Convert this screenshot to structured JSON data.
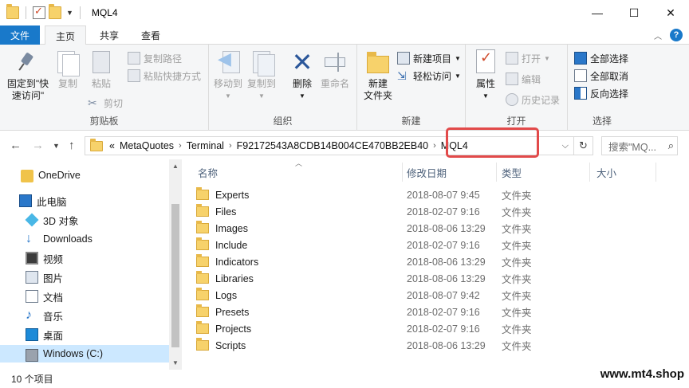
{
  "window": {
    "title": "MQL4",
    "minimize": "—",
    "maximize": "☐",
    "close": "✕"
  },
  "ribbon_tabs": {
    "file": "文件",
    "home": "主页",
    "share": "共享",
    "view": "查看"
  },
  "ribbon": {
    "clipboard": {
      "pin_label_1": "固定到\"快",
      "pin_label_2": "速访问\"",
      "copy": "复制",
      "paste": "粘贴",
      "copy_path": "复制路径",
      "paste_shortcut": "粘贴快捷方式",
      "cut": "剪切",
      "group": "剪贴板"
    },
    "organize": {
      "move_to": "移动到",
      "copy_to": "复制到",
      "delete": "删除",
      "rename": "重命名",
      "group": "组织"
    },
    "new": {
      "new_folder_1": "新建",
      "new_folder_2": "文件夹",
      "new_item": "新建项目",
      "easy_access": "轻松访问",
      "group": "新建"
    },
    "open": {
      "properties": "属性",
      "open": "打开",
      "edit": "编辑",
      "history": "历史记录",
      "group": "打开"
    },
    "select": {
      "select_all": "全部选择",
      "select_none": "全部取消",
      "invert": "反向选择",
      "group": "选择"
    }
  },
  "address": {
    "overflow": "«",
    "crumbs": [
      "MetaQuotes",
      "Terminal",
      "F92172543A8CDB14B004CE470BB2EB40",
      "MQL4"
    ],
    "search_placeholder": "搜索\"MQ..."
  },
  "nav": {
    "onedrive": "OneDrive",
    "thispc": "此电脑",
    "objects3d": "3D 对象",
    "downloads": "Downloads",
    "videos": "视频",
    "pictures": "图片",
    "documents": "文档",
    "music": "音乐",
    "desktop": "桌面",
    "drive_c": "Windows (C:)"
  },
  "columns": {
    "name": "名称",
    "modified": "修改日期",
    "type": "类型",
    "size": "大小"
  },
  "files": [
    {
      "name": "Experts",
      "date": "2018-08-07 9:45",
      "type": "文件夹"
    },
    {
      "name": "Files",
      "date": "2018-02-07 9:16",
      "type": "文件夹"
    },
    {
      "name": "Images",
      "date": "2018-08-06 13:29",
      "type": "文件夹"
    },
    {
      "name": "Include",
      "date": "2018-02-07 9:16",
      "type": "文件夹"
    },
    {
      "name": "Indicators",
      "date": "2018-08-06 13:29",
      "type": "文件夹"
    },
    {
      "name": "Libraries",
      "date": "2018-08-06 13:29",
      "type": "文件夹"
    },
    {
      "name": "Logs",
      "date": "2018-08-07 9:42",
      "type": "文件夹"
    },
    {
      "name": "Presets",
      "date": "2018-02-07 9:16",
      "type": "文件夹"
    },
    {
      "name": "Projects",
      "date": "2018-02-07 9:16",
      "type": "文件夹"
    },
    {
      "name": "Scripts",
      "date": "2018-08-06 13:29",
      "type": "文件夹"
    }
  ],
  "status": {
    "count": "10 个项目"
  },
  "watermark": "www.mt4.shop"
}
